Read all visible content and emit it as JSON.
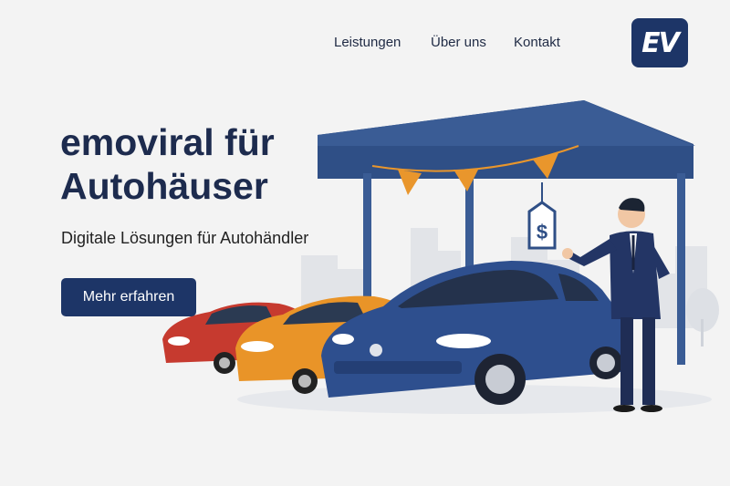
{
  "nav": {
    "items": [
      {
        "label": "Leistungen"
      },
      {
        "label": "Über uns"
      },
      {
        "label": "Kontakt"
      }
    ]
  },
  "logo": {
    "text": "EV"
  },
  "hero": {
    "title_line1": "emoviral für",
    "title_line2": "Autohäuser",
    "subtitle": "Digitale Lösungen für Autohändler",
    "cta_label": "Mehr erfahren"
  },
  "illustration": {
    "price_tag_symbol": "$"
  },
  "colors": {
    "brand": "#1d3567",
    "canopy": "#2f4f86",
    "red_car": "#c63a2f",
    "orange_car": "#e99428",
    "blue_car": "#2e4f8e",
    "pennant": "#e9962c"
  }
}
